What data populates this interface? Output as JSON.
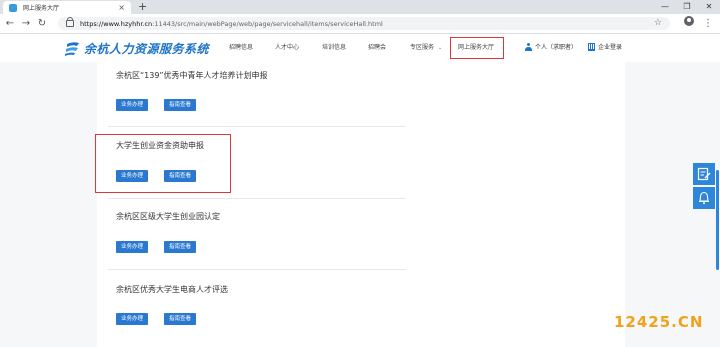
{
  "browser": {
    "tab_title": "网上服务大厅",
    "tab_close": "×",
    "new_tab": "+",
    "url_host": "https://www.hzyhhr.cn",
    "url_path": ":11443/src/main/webPage/web/page/servicehall/items/serviceHall.html",
    "back": "←",
    "forward": "→",
    "reload": "↻",
    "star": "☆",
    "menu": "⋮",
    "min": "—",
    "max": "❐",
    "close": "✕"
  },
  "site": {
    "logo_text": "余杭人力资源服务系统",
    "nav": [
      "招聘信息",
      "人才中心",
      "培训信息",
      "招聘会",
      "专区服务",
      "网上服务大厅"
    ],
    "nav_caret": "⌄",
    "personal": "个人（求职者）",
    "enterprise": "企业登录"
  },
  "items": [
    {
      "title": "余杭区“139”优秀中青年人才培养计划申报",
      "btn1": "业务办理",
      "btn2": "指南查看"
    },
    {
      "title": "大学生创业资金资助申报",
      "btn1": "业务办理",
      "btn2": "指南查看"
    },
    {
      "title": "余杭区区级大学生创业园认定",
      "btn1": "业务办理",
      "btn2": "指南查看"
    },
    {
      "title": "余杭区优秀大学生电商人才评选",
      "btn1": "业务办理",
      "btn2": "指南查看"
    }
  ],
  "watermark": "12425.CN",
  "colors": {
    "brand_blue": "#2b78d0",
    "highlight_red": "#e0353b",
    "watermark": "#f0a21a"
  }
}
